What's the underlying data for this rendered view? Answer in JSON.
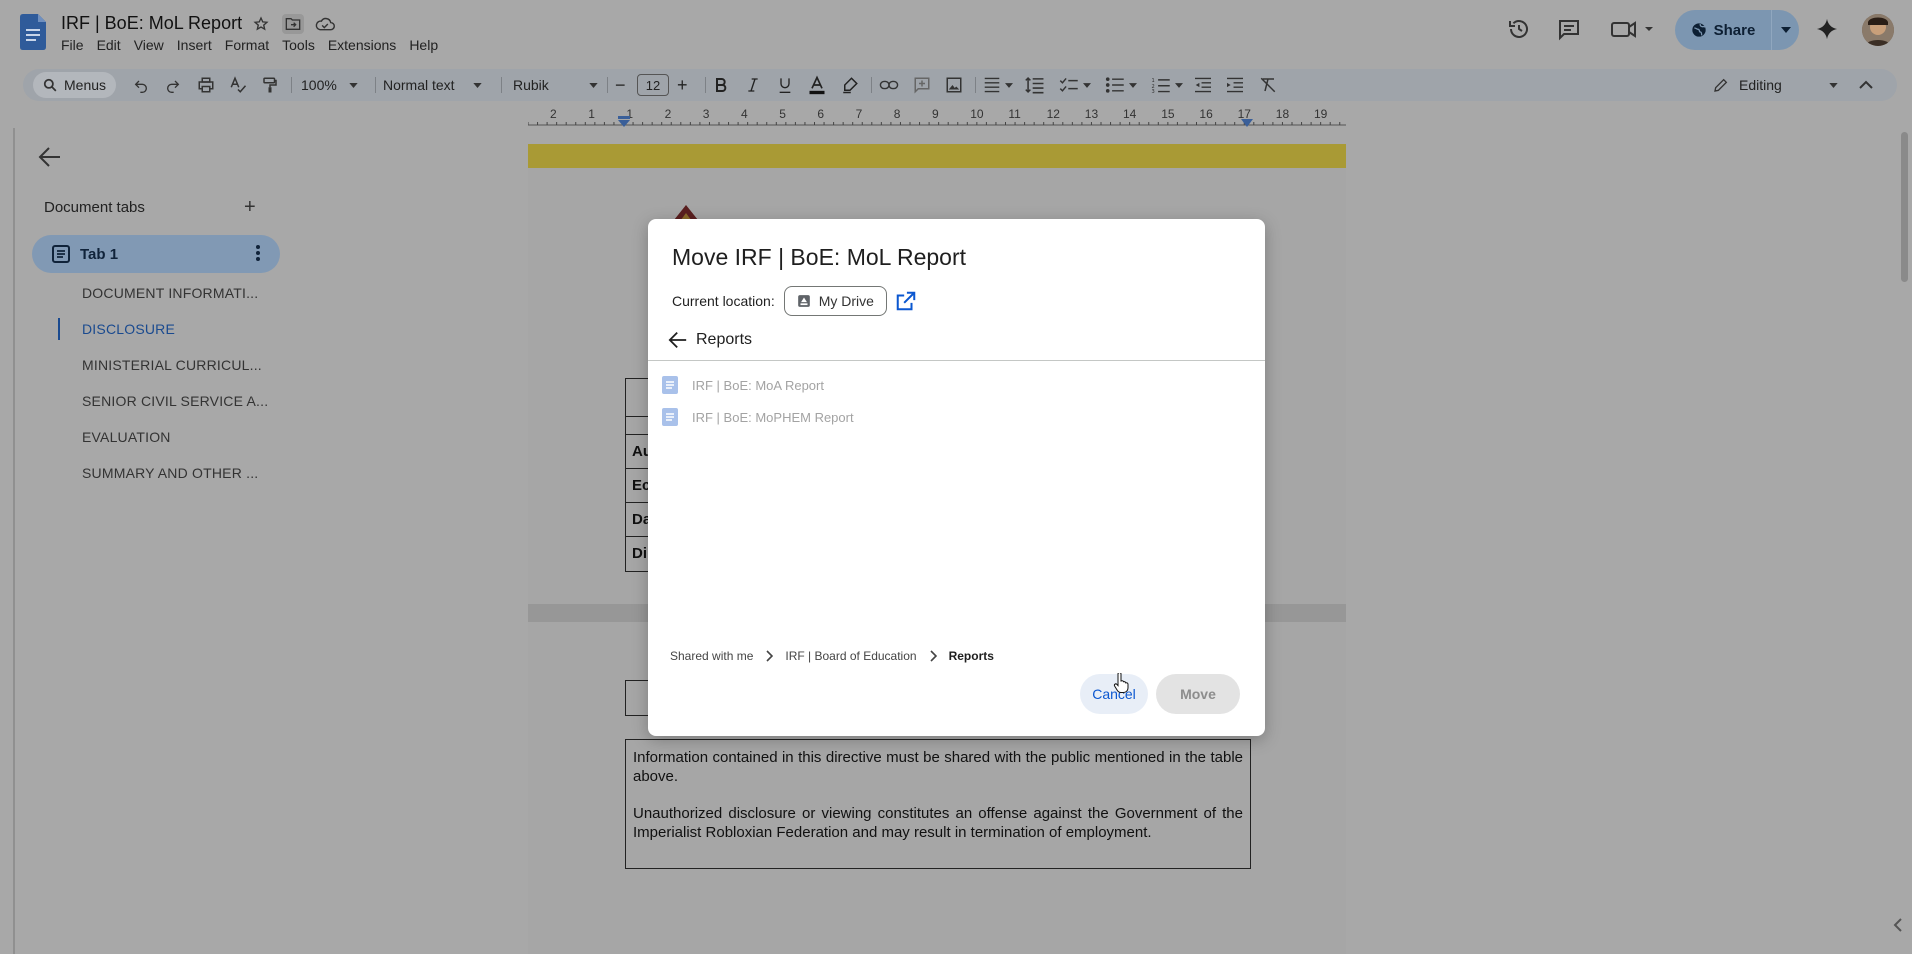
{
  "app": {
    "doc_title": "IRF | BoE: MoL Report",
    "menus": [
      "File",
      "Edit",
      "View",
      "Insert",
      "Format",
      "Tools",
      "Extensions",
      "Help"
    ],
    "share_label": "Share",
    "icons": [
      "docs-logo-icon",
      "star-icon",
      "move-folder-icon",
      "cloud-status-icon",
      "history-icon",
      "comment-icon",
      "meet-icon",
      "gemini-icon"
    ]
  },
  "toolbar": {
    "menus_label": "Menus",
    "zoom": "100%",
    "style": "Normal text",
    "font": "Rubik",
    "font_size": "12",
    "mode": "Editing"
  },
  "ruler": {
    "numbers": [
      "2",
      "1",
      "1",
      "2",
      "3",
      "4",
      "5",
      "6",
      "7",
      "8",
      "9",
      "10",
      "11",
      "12",
      "13",
      "14",
      "15",
      "16",
      "17",
      "18",
      "19"
    ]
  },
  "sidebar": {
    "heading": "Document tabs",
    "add_label": "+",
    "tab_label": "Tab 1",
    "outline": [
      {
        "label": "DOCUMENT INFORMATI..."
      },
      {
        "label": "DISCLOSURE"
      },
      {
        "label": "MINISTERIAL CURRICUL..."
      },
      {
        "label": "SENIOR CIVIL SERVICE A..."
      },
      {
        "label": "EVALUATION"
      },
      {
        "label": "SUMMARY AND OTHER ..."
      }
    ]
  },
  "document": {
    "table_cells": [
      "Au",
      "Ec",
      "Da",
      "Di"
    ],
    "notice_p1": "Information contained in this directive must be shared with the public mentioned in the table above.",
    "notice_p2": "Unauthorized disclosure or viewing constitutes an offense against the Government of the Imperialist Robloxian Federation and may result in termination of employment."
  },
  "dialog": {
    "title": "Move IRF | BoE: MoL Report",
    "current_location_label": "Current location:",
    "current_location": "My Drive",
    "folder": "Reports",
    "files": [
      {
        "name": "IRF | BoE: MoA Report"
      },
      {
        "name": "IRF | BoE: MoPHEM Report"
      }
    ],
    "breadcrumb": [
      "Shared with me",
      "IRF | Board of Education",
      "Reports"
    ],
    "cancel_label": "Cancel",
    "move_label": "Move"
  },
  "colors": {
    "accent": "#0b57d0",
    "share_button": "#7c96b1",
    "active_tab": "#8199b4",
    "doc_band": "#a99a35"
  }
}
